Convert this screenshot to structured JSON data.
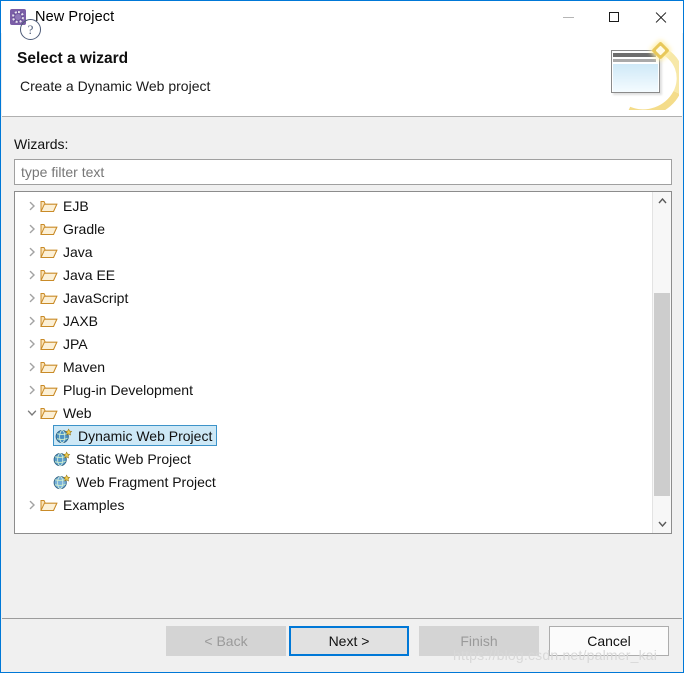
{
  "window": {
    "title": "New Project",
    "icon": "eclipse-wizard-icon",
    "controls": {
      "minimize": "minimize-icon",
      "maximize": "maximize-icon",
      "close": "close-icon"
    }
  },
  "header": {
    "title": "Select a wizard",
    "subtitle": "Create a Dynamic Web project",
    "banner_icon": "wizard-banner-icon"
  },
  "body": {
    "wizards_label": "Wizards:",
    "filter_placeholder": "type filter text",
    "filter_value": ""
  },
  "tree": {
    "items": [
      {
        "label": "EJB",
        "level": 0,
        "expanded": false,
        "icon": "folder-icon",
        "selected": false
      },
      {
        "label": "Gradle",
        "level": 0,
        "expanded": false,
        "icon": "folder-icon",
        "selected": false
      },
      {
        "label": "Java",
        "level": 0,
        "expanded": false,
        "icon": "folder-icon",
        "selected": false
      },
      {
        "label": "Java EE",
        "level": 0,
        "expanded": false,
        "icon": "folder-icon",
        "selected": false
      },
      {
        "label": "JavaScript",
        "level": 0,
        "expanded": false,
        "icon": "folder-icon",
        "selected": false
      },
      {
        "label": "JAXB",
        "level": 0,
        "expanded": false,
        "icon": "folder-icon",
        "selected": false
      },
      {
        "label": "JPA",
        "level": 0,
        "expanded": false,
        "icon": "folder-icon",
        "selected": false
      },
      {
        "label": "Maven",
        "level": 0,
        "expanded": false,
        "icon": "folder-icon",
        "selected": false
      },
      {
        "label": "Plug-in Development",
        "level": 0,
        "expanded": false,
        "icon": "folder-icon",
        "selected": false
      },
      {
        "label": "Web",
        "level": 0,
        "expanded": true,
        "icon": "folder-icon",
        "selected": false
      },
      {
        "label": "Dynamic Web Project",
        "level": 1,
        "expanded": null,
        "icon": "dynamic-web-project-icon",
        "selected": true
      },
      {
        "label": "Static Web Project",
        "level": 1,
        "expanded": null,
        "icon": "static-web-project-icon",
        "selected": false
      },
      {
        "label": "Web Fragment Project",
        "level": 1,
        "expanded": null,
        "icon": "web-fragment-project-icon",
        "selected": false
      },
      {
        "label": "Examples",
        "level": 0,
        "expanded": false,
        "icon": "folder-icon",
        "selected": false
      }
    ],
    "scrollbar": {
      "up_arrow": "chevron-up-icon",
      "down_arrow": "chevron-down-icon"
    }
  },
  "footer": {
    "help_glyph": "?",
    "buttons": {
      "back": "< Back",
      "next": "Next >",
      "finish": "Finish",
      "cancel": "Cancel"
    }
  },
  "watermark": "https://blog.csdn.net/palmer_kai",
  "colors": {
    "accent": "#0078d7",
    "selection_bg": "#cde8f6",
    "selection_border": "#3d93c9",
    "dialog_bg": "#f0f0f0",
    "folder": "#e8a33d"
  }
}
